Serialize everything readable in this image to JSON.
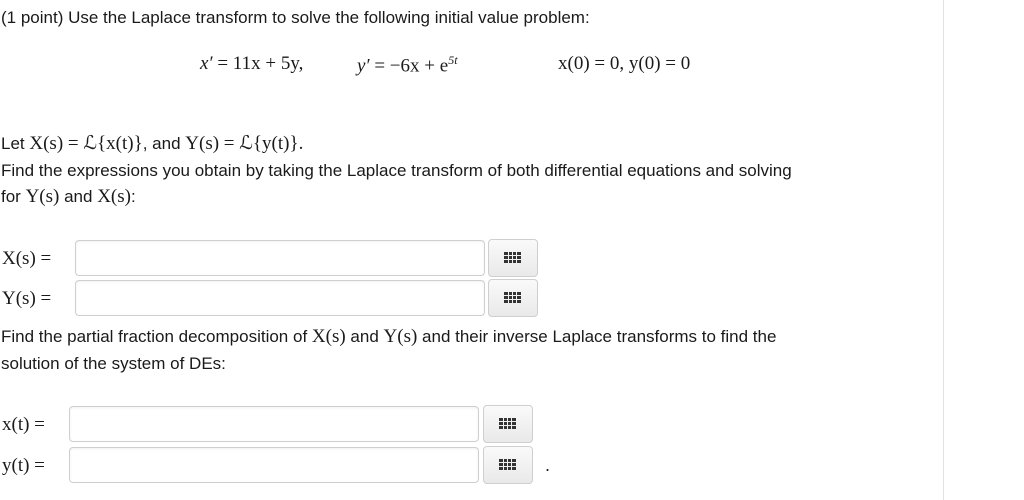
{
  "problem": {
    "intro": "(1 point) Use the Laplace transform to solve the following initial value problem:",
    "eq_lhs1": "x′",
    "eq_rhs1": "= 11x + 5y,",
    "eq_lhs2": "y′",
    "eq_rhs2a": "= −6x + e",
    "eq_exp": "5t",
    "ic": "x(0) = 0,  y(0) = 0"
  },
  "let_line": {
    "prefix": "Let",
    "def_x": "X(s) = ℒ{x(t)}",
    "mid": ", and",
    "def_y": "Y(s) = ℒ{y(t)}",
    "suffix": "."
  },
  "instruction1": {
    "line1": "Find the expressions you obtain by taking the Laplace transform of both differential equations and solving",
    "line2_prefix": "for",
    "line2_y": "Y(s)",
    "line2_and": "and",
    "line2_x": "X(s)",
    "line2_suffix": ":"
  },
  "instruction2": {
    "prefix": "Find the partial fraction decomposition of",
    "x": "X(s)",
    "and": "and",
    "y": "Y(s)",
    "suffix": "and their inverse Laplace transforms to find the",
    "line2": "solution of the system of DEs:"
  },
  "answers": {
    "Xs": {
      "label": "X(s) =",
      "value": ""
    },
    "Ys": {
      "label": "Y(s) =",
      "value": ""
    },
    "xt": {
      "label": "x(t) =",
      "value": ""
    },
    "yt": {
      "label": "y(t) =",
      "value": ""
    }
  },
  "trailing_period": ".",
  "icons": {
    "palette": "equation-editor-grid-icon"
  }
}
